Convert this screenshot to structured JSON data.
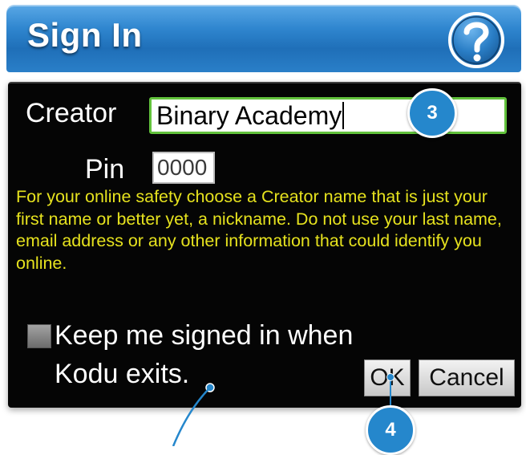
{
  "dialog": {
    "title": "Sign In",
    "help_icon": "question-mark-icon"
  },
  "form": {
    "creator_label": "Creator",
    "creator_value": "Binary Academy",
    "pin_label": "Pin",
    "pin_value": "0000",
    "safety_text": "For your online safety choose a Creator name that is just your first name or better yet, a nickname. Do not use your last name, email address or any other information that could identify you online.",
    "keep_signed_in_label": "Keep me signed in when Kodu exits.",
    "keep_signed_in_checked": false
  },
  "buttons": {
    "ok_label": "OK",
    "cancel_label": "Cancel"
  },
  "callouts": {
    "step_3": "3",
    "step_4": "4"
  },
  "colors": {
    "title_bar": "#2f86cf",
    "panel": "#050505",
    "safety_text": "#e6e21e",
    "field_focus_border": "#62c23c",
    "callout": "#2587cc"
  }
}
